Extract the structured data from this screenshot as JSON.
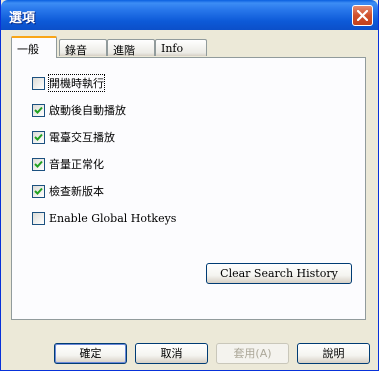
{
  "window": {
    "title": "選項"
  },
  "tabs": [
    {
      "label": "一般",
      "active": true
    },
    {
      "label": "錄音",
      "active": false
    },
    {
      "label": "進階",
      "active": false
    },
    {
      "label": "Info",
      "active": false
    }
  ],
  "options": [
    {
      "label": "開機時執行",
      "checked": false
    },
    {
      "label": "啟動後自動播放",
      "checked": true
    },
    {
      "label": "電臺交互播放",
      "checked": true
    },
    {
      "label": "音量正常化",
      "checked": true
    },
    {
      "label": "檢查新版本",
      "checked": true
    },
    {
      "label": "Enable Global Hotkeys",
      "checked": false
    }
  ],
  "clear_history_label": "Clear Search History",
  "buttons": {
    "ok": "確定",
    "cancel": "取消",
    "apply": "套用(A)",
    "help": "說明"
  },
  "colors": {
    "titlebar": "#0a5fe0",
    "face": "#ece9d8",
    "tab_highlight": "#f9a516",
    "check_mark": "#21a121"
  }
}
